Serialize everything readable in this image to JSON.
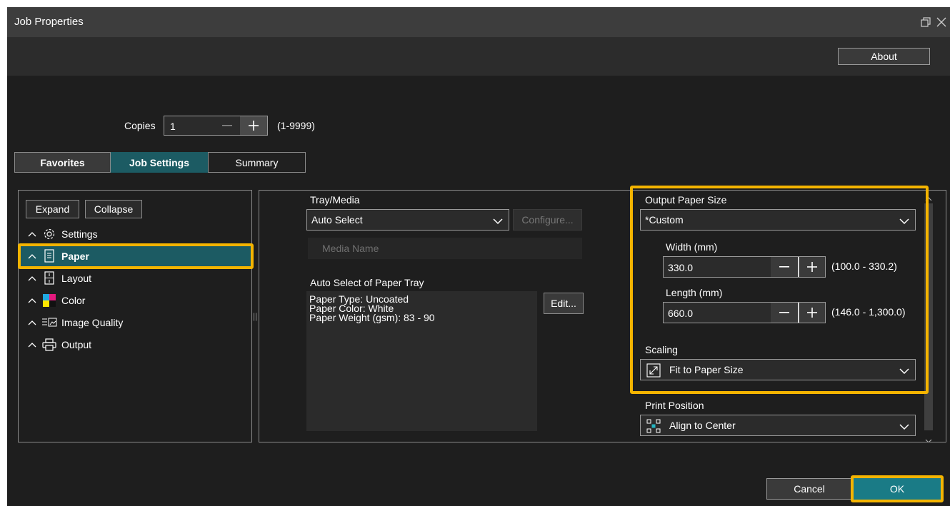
{
  "window": {
    "title": "Job Properties"
  },
  "header": {
    "about_label": "About"
  },
  "copies": {
    "label": "Copies",
    "value": "1",
    "range": "(1-9999)"
  },
  "tabs": [
    {
      "label": "Favorites"
    },
    {
      "label": "Job Settings"
    },
    {
      "label": "Summary"
    }
  ],
  "nav": {
    "expand_label": "Expand",
    "collapse_label": "Collapse",
    "items": [
      {
        "label": "Settings",
        "icon": "gear-icon"
      },
      {
        "label": "Paper",
        "icon": "paper-icon"
      },
      {
        "label": "Layout",
        "icon": "layout-icon"
      },
      {
        "label": "Color",
        "icon": "color-icon"
      },
      {
        "label": "Image Quality",
        "icon": "image-quality-icon"
      },
      {
        "label": "Output",
        "icon": "printer-icon"
      }
    ],
    "selected": "Paper"
  },
  "paper": {
    "tray_label": "Tray/Media",
    "tray_value": "Auto Select",
    "configure_label": "Configure...",
    "media_name_label": "Media Name",
    "auto_select_title": "Auto Select of Paper Tray",
    "auto_select_lines": [
      "Paper Type: Uncoated",
      "Paper Color: White",
      "Paper Weight (gsm): 83 - 90"
    ],
    "edit_label": "Edit...",
    "output_size_label": "Output Paper Size",
    "output_size_value": "*Custom",
    "width_label": "Width (mm)",
    "width_value": "330.0",
    "width_range": "(100.0 - 330.2)",
    "length_label": "Length (mm)",
    "length_value": "660.0",
    "length_range": "(146.0 - 1,300.0)",
    "scaling_label": "Scaling",
    "scaling_value": "Fit to Paper Size",
    "print_position_label": "Print Position",
    "print_position_value": "Align to Center"
  },
  "footer": {
    "cancel_label": "Cancel",
    "ok_label": "OK"
  },
  "colors": {
    "accent": "#1c5b63",
    "highlight": "#f4b400",
    "ok": "#1a7b86"
  }
}
